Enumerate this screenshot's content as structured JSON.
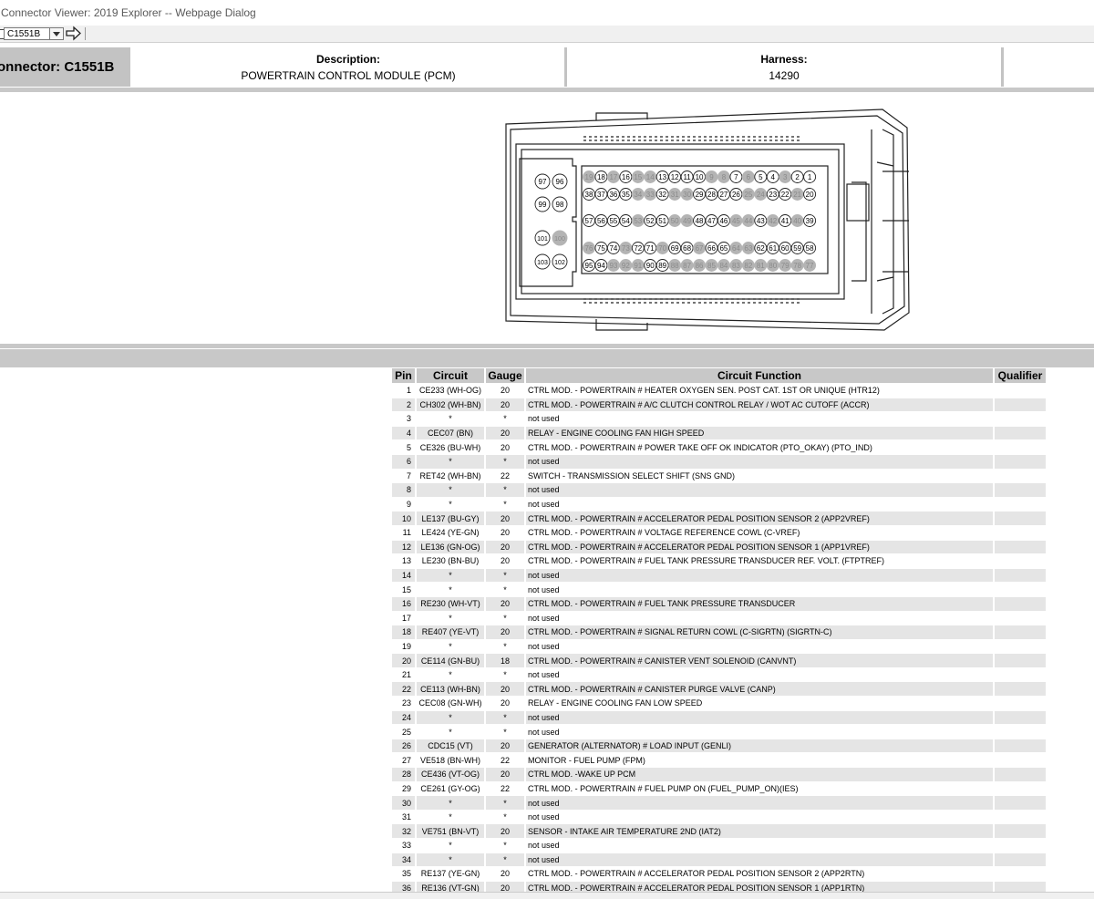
{
  "window": {
    "title": "Connector Viewer: 2019 Explorer -- Webpage Dialog"
  },
  "toolbar": {
    "connector_select": "C1551B"
  },
  "header": {
    "connector_label": "onnector: C1551B",
    "description_label": "Description:",
    "description_value": "POWERTRAIN CONTROL MODULE (PCM)",
    "harness_label": "Harness:",
    "harness_value": "14290"
  },
  "diagram": {
    "row1": [
      "19",
      "18",
      "17",
      "16",
      "15",
      "14",
      "13",
      "12",
      "11",
      "10",
      "9",
      "8",
      "7",
      "6",
      "5",
      "4",
      "3",
      "2",
      "1"
    ],
    "row2": [
      "38",
      "37",
      "36",
      "35",
      "34",
      "33",
      "32",
      "31",
      "30",
      "29",
      "28",
      "27",
      "26",
      "25",
      "24",
      "23",
      "22",
      "21",
      "20"
    ],
    "row3": [
      "57",
      "56",
      "55",
      "54",
      "53",
      "52",
      "51",
      "50",
      "49",
      "48",
      "47",
      "46",
      "45",
      "44",
      "43",
      "42",
      "41",
      "40",
      "39"
    ],
    "row4": [
      "76",
      "75",
      "74",
      "73",
      "72",
      "71",
      "70",
      "69",
      "68",
      "67",
      "66",
      "65",
      "64",
      "63",
      "62",
      "61",
      "60",
      "59",
      "58"
    ],
    "row5": [
      "95",
      "94",
      "93",
      "92",
      "91",
      "90",
      "89",
      "88",
      "87",
      "86",
      "85",
      "84",
      "83",
      "82",
      "81",
      "80",
      "79",
      "78",
      "77"
    ],
    "left_pins": [
      "97",
      "96",
      "99",
      "98",
      "101",
      "100",
      "103",
      "102"
    ],
    "unused_pins": [
      "19",
      "17",
      "15",
      "14",
      "9",
      "8",
      "6",
      "3",
      "34",
      "33",
      "31",
      "30",
      "25",
      "24",
      "21",
      "53",
      "50",
      "49",
      "45",
      "44",
      "42",
      "40",
      "76",
      "73",
      "70",
      "67",
      "64",
      "63",
      "93",
      "92",
      "91",
      "88",
      "87",
      "86",
      "85",
      "84",
      "83",
      "82",
      "81",
      "80",
      "79",
      "78",
      "77",
      "100"
    ]
  },
  "table": {
    "headers": {
      "pin": "Pin",
      "circuit": "Circuit",
      "gauge": "Gauge",
      "function": "Circuit Function",
      "qualifier": "Qualifier"
    },
    "rows": [
      {
        "pin": "1",
        "circuit": "CE233 (WH-OG)",
        "gauge": "20",
        "function": "CTRL MOD. - POWERTRAIN # HEATER OXYGEN SEN. POST CAT. 1ST OR UNIQUE (HTR12)",
        "qualifier": ""
      },
      {
        "pin": "2",
        "circuit": "CH302 (WH-BN)",
        "gauge": "20",
        "function": "CTRL MOD. - POWERTRAIN # A/C CLUTCH CONTROL RELAY / WOT AC CUTOFF (ACCR)",
        "qualifier": ""
      },
      {
        "pin": "3",
        "circuit": "*",
        "gauge": "*",
        "function": "not used",
        "qualifier": ""
      },
      {
        "pin": "4",
        "circuit": "CEC07 (BN)",
        "gauge": "20",
        "function": "RELAY - ENGINE COOLING FAN HIGH SPEED",
        "qualifier": ""
      },
      {
        "pin": "5",
        "circuit": "CE326 (BU-WH)",
        "gauge": "20",
        "function": "CTRL MOD. - POWERTRAIN # POWER TAKE OFF OK INDICATOR (PTO_OKAY) (PTO_IND)",
        "qualifier": ""
      },
      {
        "pin": "6",
        "circuit": "*",
        "gauge": "*",
        "function": "not used",
        "qualifier": ""
      },
      {
        "pin": "7",
        "circuit": "RET42 (WH-BN)",
        "gauge": "22",
        "function": "SWITCH - TRANSMISSION SELECT SHIFT (SNS GND)",
        "qualifier": ""
      },
      {
        "pin": "8",
        "circuit": "*",
        "gauge": "*",
        "function": "not used",
        "qualifier": ""
      },
      {
        "pin": "9",
        "circuit": "*",
        "gauge": "*",
        "function": "not used",
        "qualifier": ""
      },
      {
        "pin": "10",
        "circuit": "LE137 (BU-GY)",
        "gauge": "20",
        "function": "CTRL MOD. - POWERTRAIN # ACCELERATOR PEDAL POSITION SENSOR 2 (APP2VREF)",
        "qualifier": ""
      },
      {
        "pin": "11",
        "circuit": "LE424 (YE-GN)",
        "gauge": "20",
        "function": "CTRL MOD. - POWERTRAIN # VOLTAGE REFERENCE COWL (C-VREF)",
        "qualifier": ""
      },
      {
        "pin": "12",
        "circuit": "LE136 (GN-OG)",
        "gauge": "20",
        "function": "CTRL MOD. - POWERTRAIN # ACCELERATOR PEDAL POSITION SENSOR 1 (APP1VREF)",
        "qualifier": ""
      },
      {
        "pin": "13",
        "circuit": "LE230 (BN-BU)",
        "gauge": "20",
        "function": "CTRL MOD. - POWERTRAIN # FUEL TANK PRESSURE TRANSDUCER REF. VOLT. (FTPTREF)",
        "qualifier": ""
      },
      {
        "pin": "14",
        "circuit": "*",
        "gauge": "*",
        "function": "not used",
        "qualifier": ""
      },
      {
        "pin": "15",
        "circuit": "*",
        "gauge": "*",
        "function": "not used",
        "qualifier": ""
      },
      {
        "pin": "16",
        "circuit": "RE230 (WH-VT)",
        "gauge": "20",
        "function": "CTRL MOD. - POWERTRAIN # FUEL TANK PRESSURE TRANSDUCER",
        "qualifier": ""
      },
      {
        "pin": "17",
        "circuit": "*",
        "gauge": "*",
        "function": "not used",
        "qualifier": ""
      },
      {
        "pin": "18",
        "circuit": "RE407 (YE-VT)",
        "gauge": "20",
        "function": "CTRL MOD. - POWERTRAIN # SIGNAL RETURN COWL (C-SIGRTN) (SIGRTN-C)",
        "qualifier": ""
      },
      {
        "pin": "19",
        "circuit": "*",
        "gauge": "*",
        "function": "not used",
        "qualifier": ""
      },
      {
        "pin": "20",
        "circuit": "CE114 (GN-BU)",
        "gauge": "18",
        "function": "CTRL MOD. - POWERTRAIN # CANISTER VENT SOLENOID (CANVNT)",
        "qualifier": ""
      },
      {
        "pin": "21",
        "circuit": "*",
        "gauge": "*",
        "function": "not used",
        "qualifier": ""
      },
      {
        "pin": "22",
        "circuit": "CE113 (WH-BN)",
        "gauge": "20",
        "function": "CTRL MOD. - POWERTRAIN # CANISTER PURGE VALVE (CANP)",
        "qualifier": ""
      },
      {
        "pin": "23",
        "circuit": "CEC08 (GN-WH)",
        "gauge": "20",
        "function": "RELAY - ENGINE COOLING FAN LOW SPEED",
        "qualifier": ""
      },
      {
        "pin": "24",
        "circuit": "*",
        "gauge": "*",
        "function": "not used",
        "qualifier": ""
      },
      {
        "pin": "25",
        "circuit": "*",
        "gauge": "*",
        "function": "not used",
        "qualifier": ""
      },
      {
        "pin": "26",
        "circuit": "CDC15 (VT)",
        "gauge": "20",
        "function": "GENERATOR (ALTERNATOR) # LOAD INPUT (GENLI)",
        "qualifier": ""
      },
      {
        "pin": "27",
        "circuit": "VE518 (BN-WH)",
        "gauge": "22",
        "function": "MONITOR - FUEL PUMP (FPM)",
        "qualifier": ""
      },
      {
        "pin": "28",
        "circuit": "CE436 (VT-OG)",
        "gauge": "20",
        "function": "CTRL MOD. -WAKE UP PCM",
        "qualifier": ""
      },
      {
        "pin": "29",
        "circuit": "CE261 (GY-OG)",
        "gauge": "22",
        "function": "CTRL MOD. - POWERTRAIN # FUEL PUMP ON (FUEL_PUMP_ON)(IES)",
        "qualifier": ""
      },
      {
        "pin": "30",
        "circuit": "*",
        "gauge": "*",
        "function": "not used",
        "qualifier": ""
      },
      {
        "pin": "31",
        "circuit": "*",
        "gauge": "*",
        "function": "not used",
        "qualifier": ""
      },
      {
        "pin": "32",
        "circuit": "VE751 (BN-VT)",
        "gauge": "20",
        "function": "SENSOR - INTAKE AIR TEMPERATURE 2ND (IAT2)",
        "qualifier": ""
      },
      {
        "pin": "33",
        "circuit": "*",
        "gauge": "*",
        "function": "not used",
        "qualifier": ""
      },
      {
        "pin": "34",
        "circuit": "*",
        "gauge": "*",
        "function": "not used",
        "qualifier": ""
      },
      {
        "pin": "35",
        "circuit": "RE137 (YE-GN)",
        "gauge": "20",
        "function": "CTRL MOD. - POWERTRAIN # ACCELERATOR PEDAL POSITION SENSOR 2 (APP2RTN)",
        "qualifier": ""
      },
      {
        "pin": "36",
        "circuit": "RE136 (VT-GN)",
        "gauge": "20",
        "function": "CTRL MOD. - POWERTRAIN # ACCELERATOR PEDAL POSITION SENSOR 1 (APP1RTN)",
        "qualifier": ""
      }
    ]
  }
}
